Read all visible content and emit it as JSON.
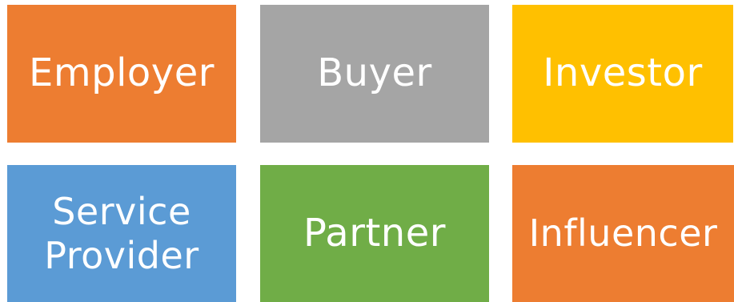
{
  "tiles": [
    {
      "label": "Employer",
      "color": "#ED7D31"
    },
    {
      "label": "Buyer",
      "color": "#A5A5A5"
    },
    {
      "label": "Investor",
      "color": "#FFC000"
    },
    {
      "label": "Service\nProvider",
      "color": "#5B9BD5"
    },
    {
      "label": "Partner",
      "color": "#70AD47"
    },
    {
      "label": "Influencer",
      "color": "#ED7D31"
    }
  ]
}
